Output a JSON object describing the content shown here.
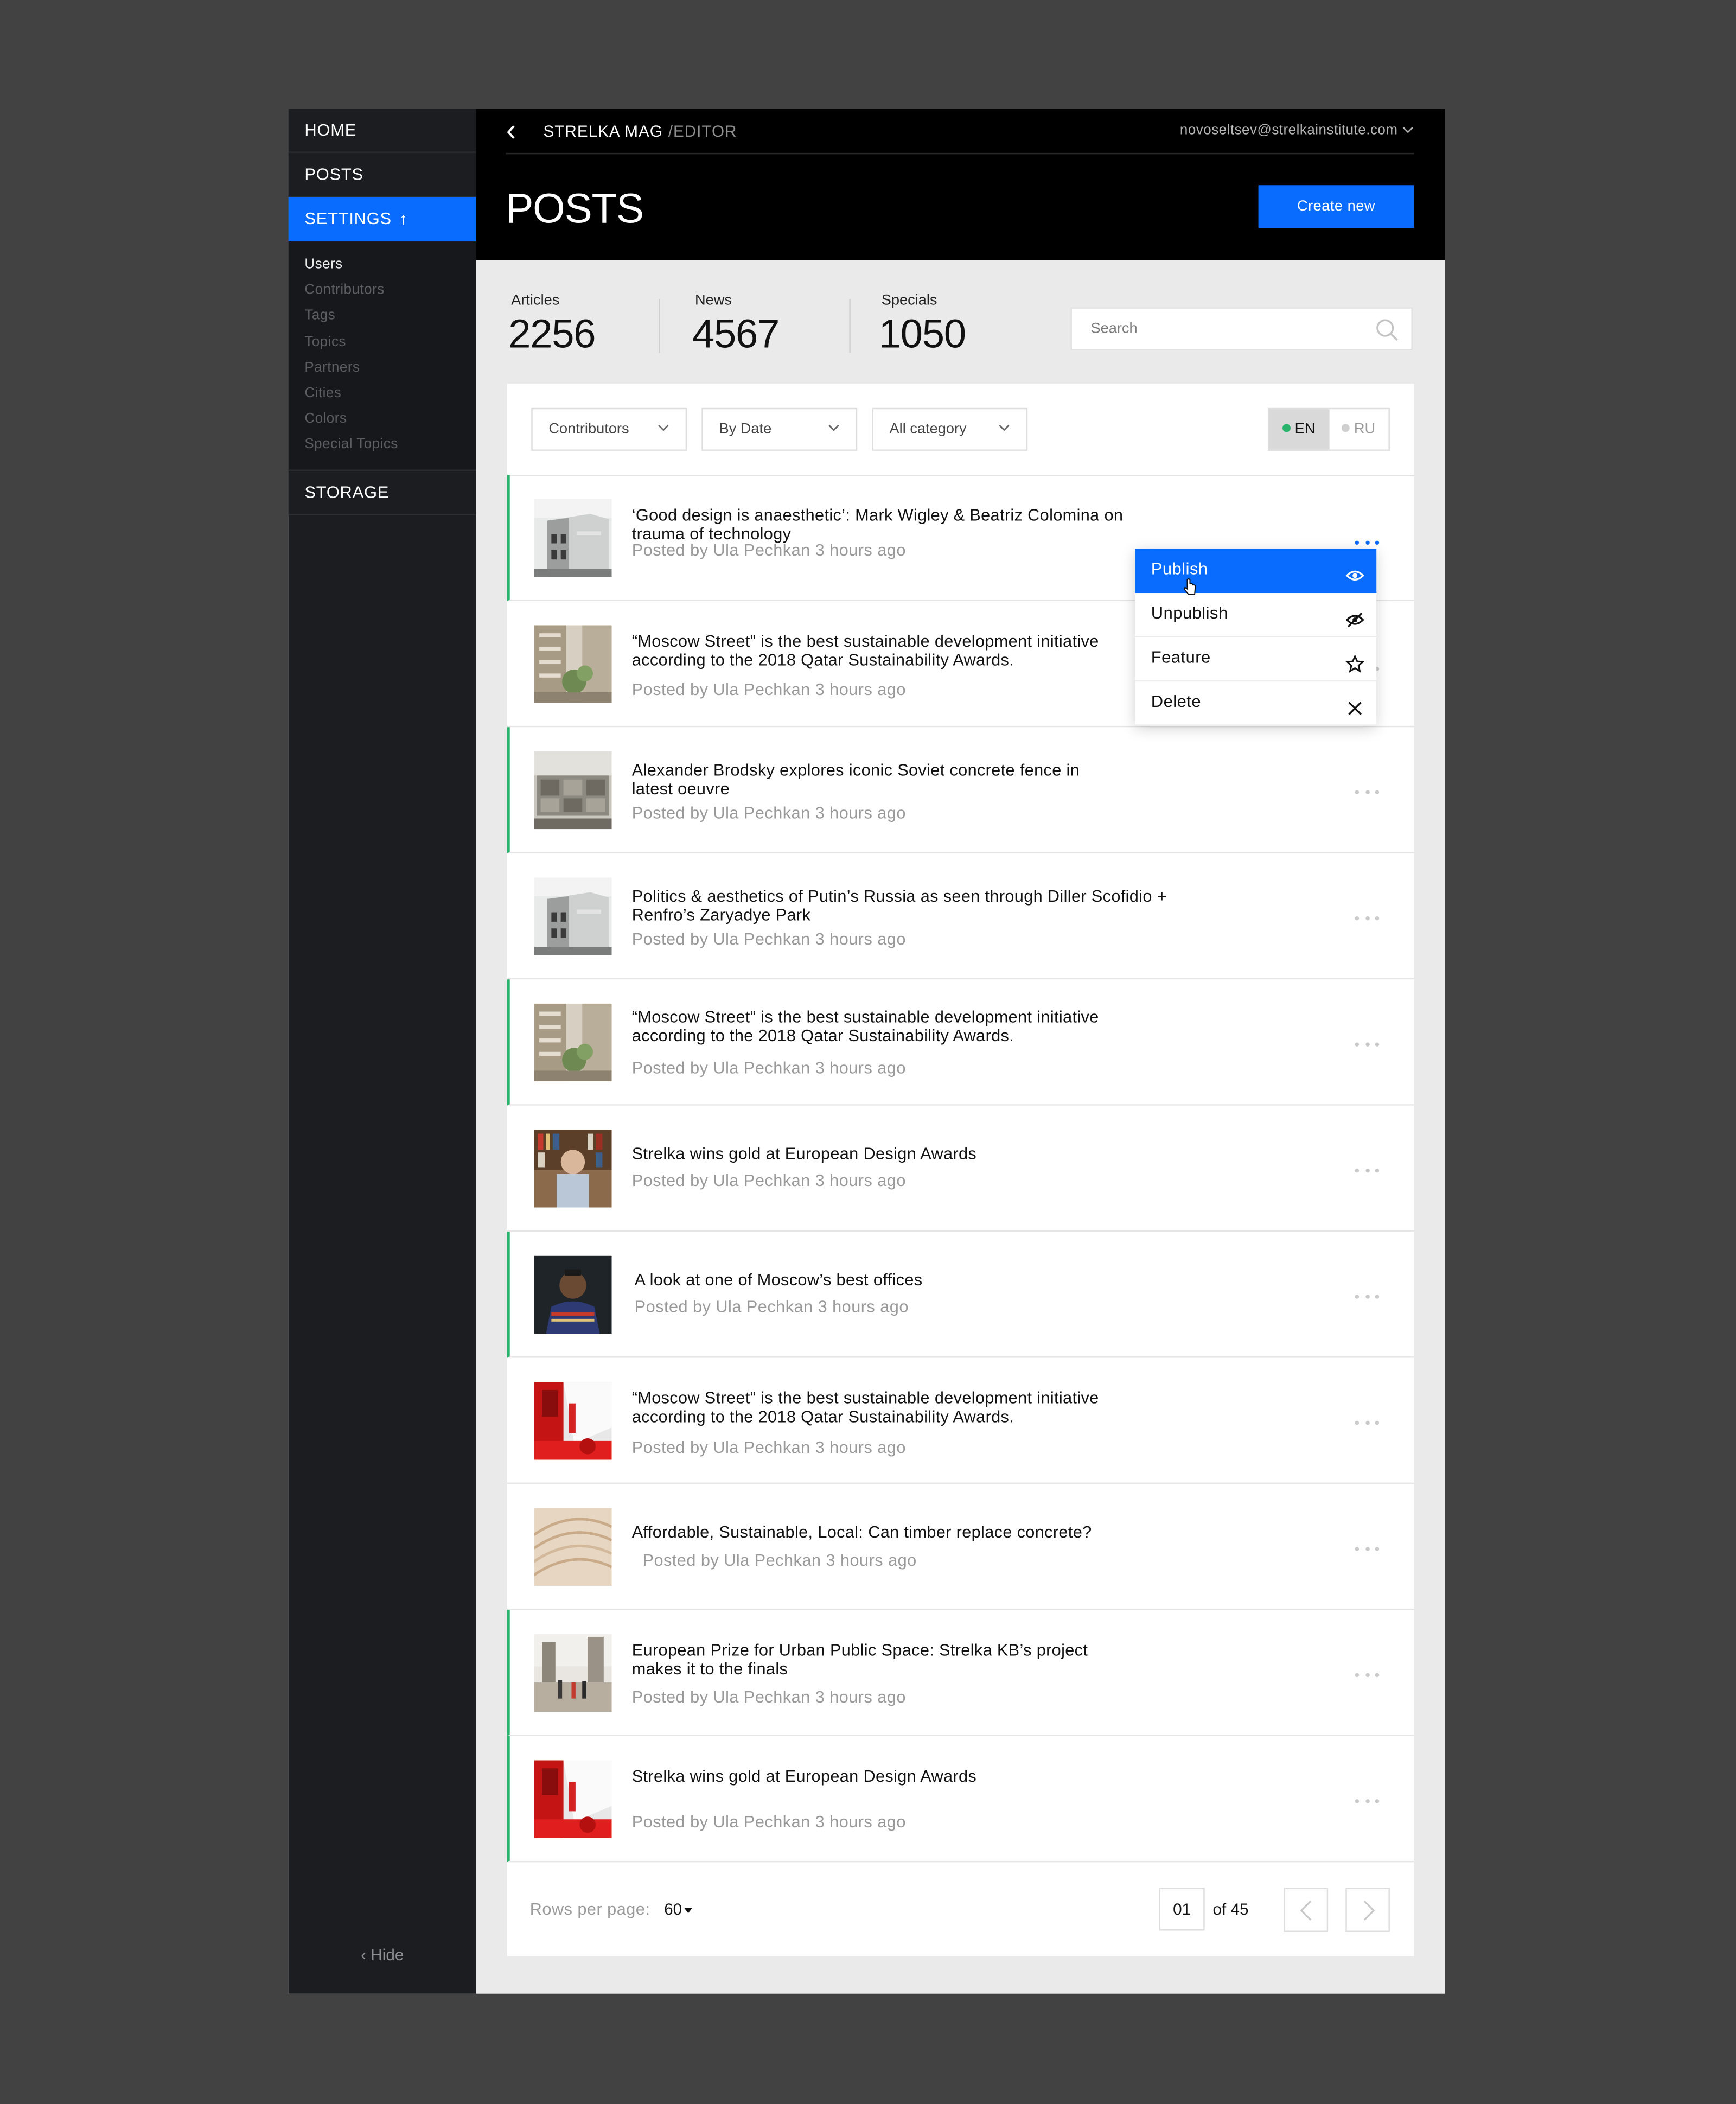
{
  "sidebar": {
    "nav": [
      {
        "label": "HOME",
        "active": false
      },
      {
        "label": "POSTS",
        "active": false
      },
      {
        "label": "SETTINGS",
        "active": true
      }
    ],
    "settings_arrow": "↑",
    "subnav": [
      "Users",
      "Contributors",
      "Tags",
      "Topics",
      "Partners",
      "Cities",
      "Colors",
      "Special Topics"
    ],
    "storage": "STORAGE",
    "hide": "‹ Hide"
  },
  "header": {
    "brand": "STRELKA MAG",
    "section": "/EDITOR",
    "user_email": "novoseltsev@strelkainstitute.com",
    "title": "POSTS",
    "create_label": "Create new"
  },
  "stats": [
    {
      "label": "Articles",
      "value": "2256"
    },
    {
      "label": "News",
      "value": "4567"
    },
    {
      "label": "Specials",
      "value": "1050"
    }
  ],
  "search": {
    "placeholder": "Search"
  },
  "filters": {
    "contributors": "Contributors",
    "date": "By Date",
    "category": "All category",
    "lang_en": "EN",
    "lang_ru": "RU"
  },
  "posts": [
    {
      "title": "‘Good design is anaesthetic’: Mark Wigley & Beatriz Colomina on trauma of technology",
      "meta": "Posted by Ula Pechkan 3 hours ago",
      "thumb": "building"
    },
    {
      "title": "“Moscow Street” is the best sustainable development initiative according to the 2018 Qatar Sustainability Awards.",
      "meta": "Posted by Ula Pechkan 3 hours ago",
      "thumb": "street"
    },
    {
      "title": "Alexander Brodsky explores iconic Soviet concrete fence in latest oeuvre",
      "meta": "Posted by Ula Pechkan 3 hours ago",
      "thumb": "fence"
    },
    {
      "title": "Politics & aesthetics of Putin’s Russia as seen through Diller Scofidio + Renfro’s Zaryadye Park",
      "meta": "Posted by Ula Pechkan 3 hours ago",
      "thumb": "building"
    },
    {
      "title": "“Moscow Street” is the best sustainable development initiative according to the 2018 Qatar Sustainability Awards.",
      "meta": "Posted by Ula Pechkan 3 hours ago",
      "thumb": "street"
    },
    {
      "title": "Strelka wins gold at European Design Awards",
      "meta": "Posted by Ula Pechkan 3 hours ago",
      "thumb": "library"
    },
    {
      "title": "A look at one of Moscow’s best offices",
      "meta": "Posted by Ula Pechkan 3 hours ago",
      "thumb": "portrait"
    },
    {
      "title": "“Moscow Street” is the best sustainable development initiative according to the 2018 Qatar Sustainability Awards.",
      "meta": "Posted by Ula Pechkan 3 hours ago",
      "thumb": "red"
    },
    {
      "title": "Affordable, Sustainable, Local: Can timber replace concrete?",
      "meta": "Posted by Ula Pechkan 3 hours ago",
      "thumb": "wood"
    },
    {
      "title": "European Prize for Urban Public Space: Strelka KB’s project makes it to the finals",
      "meta": "Posted by Ula Pechkan 3 hours ago",
      "thumb": "park"
    },
    {
      "title": "Strelka wins gold at European Design Awards",
      "meta": "Posted by Ula Pechkan 3 hours ago",
      "thumb": "red"
    }
  ],
  "action_menu": [
    {
      "label": "Publish",
      "icon": "eye-icon"
    },
    {
      "label": "Unpublish",
      "icon": "eye-off-icon"
    },
    {
      "label": "Feature",
      "icon": "star-icon"
    },
    {
      "label": "Delete",
      "icon": "close-icon"
    }
  ],
  "pagination": {
    "rows_label": "Rows per page:",
    "rows_value": "60",
    "page": "01",
    "of_label": "of 45"
  },
  "colors": {
    "accent": "#0a6cff",
    "flag": "#2ab36b",
    "header": "#000000",
    "sidebar": "#1c1d20"
  }
}
